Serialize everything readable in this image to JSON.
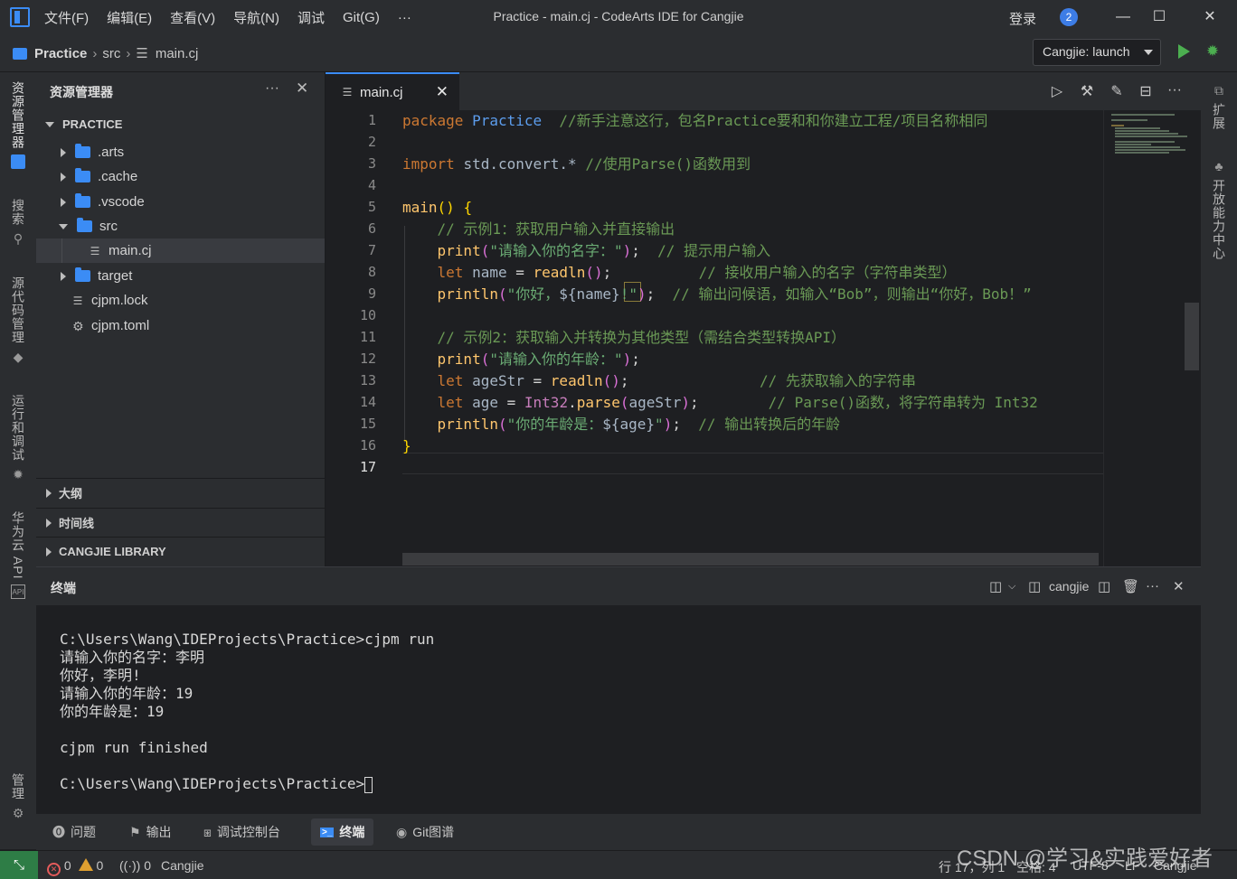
{
  "titlebar": {
    "menus": [
      "文件(F)",
      "编辑(E)",
      "查看(V)",
      "导航(N)",
      "调试",
      "Git(G)",
      "···"
    ],
    "window_title": "Practice - main.cj - CodeArts IDE for Cangjie",
    "login": "登录",
    "notification_count": "2"
  },
  "breadcrumb": {
    "project": "Practice",
    "folder": "src",
    "file": "main.cj"
  },
  "launch": {
    "config": "Cangjie: launch"
  },
  "activitybar": [
    "资源管理器",
    "搜索",
    "源代码管理",
    "运行和调试",
    "华为云 API",
    "管理"
  ],
  "rightbar": [
    "扩展",
    "开放能力中心"
  ],
  "explorer": {
    "title": "资源管理器",
    "root": "PRACTICE",
    "items": [
      {
        "label": ".arts",
        "kind": "folder",
        "state": "closed"
      },
      {
        "label": ".cache",
        "kind": "folder",
        "state": "closed"
      },
      {
        "label": ".vscode",
        "kind": "folder",
        "state": "closed"
      },
      {
        "label": "src",
        "kind": "folder",
        "state": "open"
      },
      {
        "label": "main.cj",
        "kind": "file",
        "selected": true
      },
      {
        "label": "target",
        "kind": "folder",
        "state": "closed"
      },
      {
        "label": "cjpm.lock",
        "kind": "file"
      },
      {
        "label": "cjpm.toml",
        "kind": "settings-file"
      }
    ],
    "sections": [
      "大纲",
      "时间线",
      "CANGJIE LIBRARY"
    ]
  },
  "editor": {
    "tab": "main.cj",
    "active_line": 17,
    "line_numbers": [
      "1",
      "2",
      "3",
      "4",
      "5",
      "6",
      "7",
      "8",
      "9",
      "10",
      "11",
      "12",
      "13",
      "14",
      "15",
      "16",
      "17"
    ]
  },
  "code": {
    "l1_kw": "package",
    "l1_name": "Practice",
    "l1_cm": "//新手注意这行，包名Practice要和和你建立工程/项目名称相同",
    "l3_kw": "import",
    "l3_mod": "std.convert.*",
    "l3_cm": "//使用Parse()函数用到",
    "l5_fn": "main",
    "l6_cm": "// 示例1：获取用户输入并直接输出",
    "l7_fn": "print",
    "l7_str": "\"请输入你的名字：\"",
    "l7_cm": "// 提示用户输入",
    "l8_kw": "let",
    "l8_var": "name",
    "l8_fn": "readln",
    "l8_cm": "// 接收用户输入的名字（字符串类型）",
    "l9_fn": "println",
    "l9_str1": "\"你好，",
    "l9_interp": "${name}",
    "l9_str2": "!\"",
    "l9_cm": "// 输出问候语，如输入“Bob”，则输出“你好，Bob！”",
    "l11_cm": "// 示例2：获取输入并转换为其他类型（需结合类型转换API）",
    "l12_fn": "print",
    "l12_str": "\"请输入你的年龄：\"",
    "l13_kw": "let",
    "l13_var": "ageStr",
    "l13_fn": "readln",
    "l13_cm": "// 先获取输入的字符串",
    "l14_kw": "let",
    "l14_var": "age",
    "l14_type": "Int32",
    "l14_fn": "parse",
    "l14_arg": "ageStr",
    "l14_cm": "// Parse()函数，将字符串转为 Int32",
    "l15_fn": "println",
    "l15_str1": "\"你的年龄是：",
    "l15_interp": "${age}",
    "l15_str2": "\"",
    "l15_cm": "// 输出转换后的年龄"
  },
  "terminal": {
    "title": "终端",
    "profile": "cangjie",
    "lines": [
      "C:\\Users\\Wang\\IDEProjects\\Practice>cjpm run",
      "请输入你的名字：李明",
      "你好，李明!",
      "请输入你的年龄：19",
      "你的年龄是：19",
      "",
      "cjpm run finished",
      "",
      "C:\\Users\\Wang\\IDEProjects\\Practice>"
    ]
  },
  "panel_tabs": [
    "问题",
    "输出",
    "调试控制台",
    "终端",
    "Git图谱"
  ],
  "panel_active": "终端",
  "statusbar": {
    "errors": "0",
    "warnings": "0",
    "ports": "0",
    "language_left": "Cangjie",
    "position": "行 17，列 1",
    "spaces": "空格: 4",
    "encoding": "UTF-8",
    "eol": "LF",
    "language_right": "Cangjie"
  },
  "watermark": "CSDN @学习&实践爱好者",
  "colors": {
    "accent": "#3b8cf5",
    "run": "#4caf50",
    "remote": "#2e7d46"
  }
}
